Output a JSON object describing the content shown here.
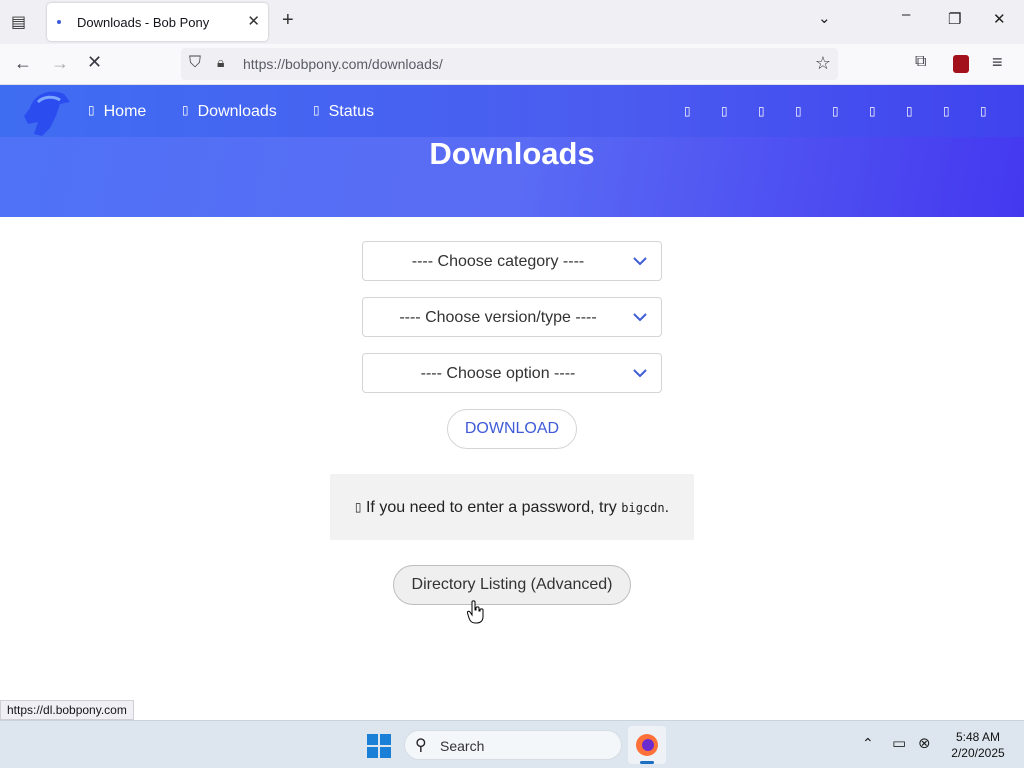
{
  "browser": {
    "tab_title": "Downloads - Bob Pony",
    "url_host": "https://bobpony.com",
    "url_path": "/downloads/",
    "status_url": "https://dl.bobpony.com"
  },
  "site": {
    "nav": [
      {
        "label": "Home",
        "icon": "home-icon"
      },
      {
        "label": "Downloads",
        "icon": "download-icon"
      },
      {
        "label": "Status",
        "icon": "status-icon"
      }
    ],
    "social_icons": [
      "social-icon-1",
      "social-icon-2",
      "social-icon-3",
      "social-icon-4",
      "social-icon-5",
      "social-icon-6",
      "social-icon-7",
      "social-icon-8",
      "social-icon-9"
    ],
    "hero_title": "Downloads"
  },
  "form": {
    "category_placeholder": "---- Choose category ----",
    "version_placeholder": "---- Choose version/type ----",
    "option_placeholder": "---- Choose option ----",
    "download_label": "DOWNLOAD",
    "notice_text": "If you need to enter a password, try",
    "notice_code": "bigcdn",
    "notice_end": ".",
    "directory_label": "Directory Listing (Advanced)"
  },
  "taskbar": {
    "search_label": "Search",
    "time": "5:48 AM",
    "date": "2/20/2025"
  },
  "colors": {
    "brand": "#4b5cf0",
    "link": "#3f5bd6"
  }
}
